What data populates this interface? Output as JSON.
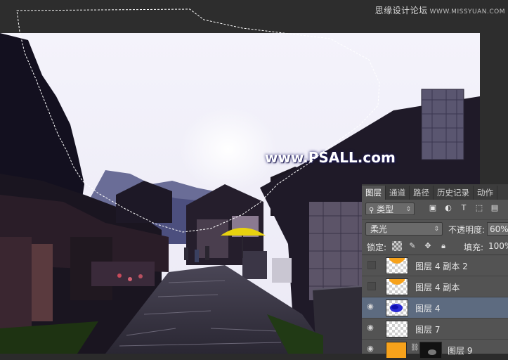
{
  "watermark": {
    "text": "思缘设计论坛",
    "site": "WWW.MISSYUAN.COM"
  },
  "overlay": {
    "psall_text": "www.PSALL.com"
  },
  "panel": {
    "tabs": [
      {
        "label": "图层"
      },
      {
        "label": "通道"
      },
      {
        "label": "路径"
      },
      {
        "label": "历史记录"
      },
      {
        "label": "动作"
      }
    ],
    "filter": {
      "label": "类型"
    },
    "blend_mode": "柔光",
    "opacity_label": "不透明度:",
    "opacity_value": "60%",
    "lock_label": "锁定:",
    "fill_label": "填充:",
    "fill_value": "100%",
    "layers": [
      {
        "name": "图层 4 副本 2",
        "visible": false
      },
      {
        "name": "图层 4 副本",
        "visible": false
      },
      {
        "name": "图层 4",
        "visible": true,
        "selected": true
      },
      {
        "name": "图层 7",
        "visible": true
      },
      {
        "name": "图层 9",
        "visible": true
      }
    ]
  },
  "colors": {
    "layer_selected": "#5d6b80",
    "panel_bg": "#535353",
    "orange_fill": "#f7a21b",
    "blue_blob": "#2b2bd6"
  }
}
